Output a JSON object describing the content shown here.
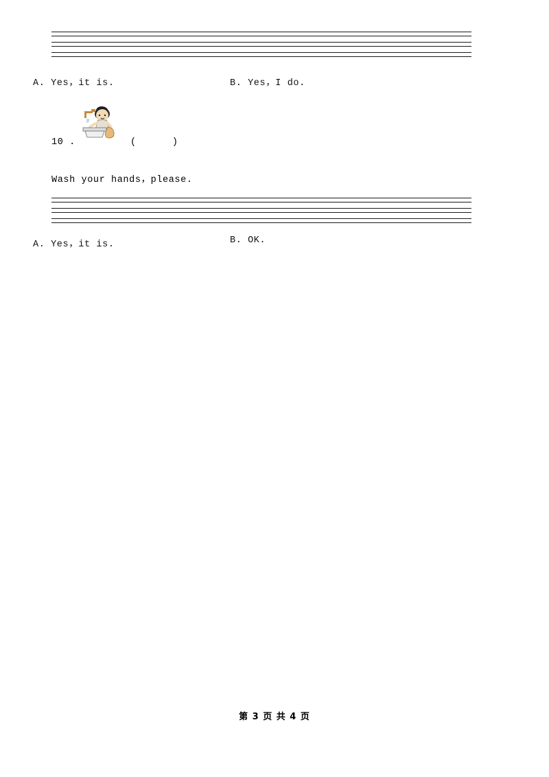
{
  "document": {
    "footer": "第 3 页 共 4 页",
    "blocks": [
      {
        "id": "answer-lines-1",
        "type": "ruled-lines",
        "line_count": 4
      },
      {
        "id": "options-1",
        "type": "options",
        "option_a": "A. Yes，it is.",
        "option_b": "B. Yes，I do."
      },
      {
        "id": "question-10",
        "type": "question",
        "number": "10 .",
        "blank": "(      )",
        "image_alt": "boy-washing-hands-icon",
        "sentence": "Wash your hands，please."
      },
      {
        "id": "answer-lines-2",
        "type": "ruled-lines",
        "line_count": 4
      },
      {
        "id": "options-2",
        "type": "options",
        "option_a": "A. Yes，it is.",
        "option_b": "B. OK."
      }
    ]
  }
}
